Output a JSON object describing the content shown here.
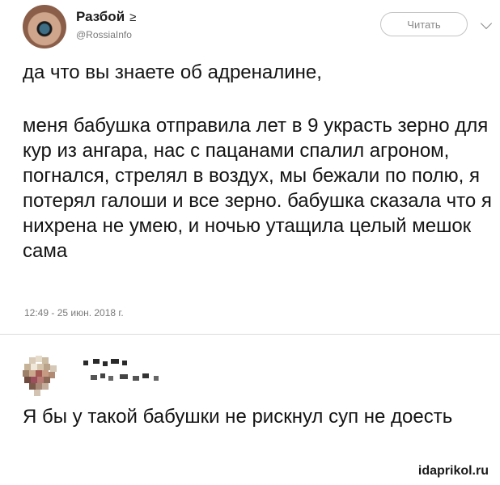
{
  "tweet": {
    "author_name": "Разбой",
    "author_suffix": "≥",
    "handle": "@RossiaInfo",
    "follow_label": "Читать",
    "paragraph_1": "да что вы знаете об адреналине,",
    "paragraph_2": "меня бабушка отправила лет в 9 украсть зерно для кур из ангара, нас с пацанами спалил агроном, погнался, стрелял в воздух, мы бежали по полю, я потерял галоши и все зерно. бабушка сказала что я нихрена не умею, и ночью утащила целый мешок сама",
    "timestamp": "12:49 - 25 июн. 2018 г."
  },
  "reply": {
    "text": "Я бы у такой бабушки не рискнул суп не доесть"
  },
  "watermark": "idaprikol.ru",
  "icons": {
    "follow_menu": "chevron-down-icon"
  }
}
